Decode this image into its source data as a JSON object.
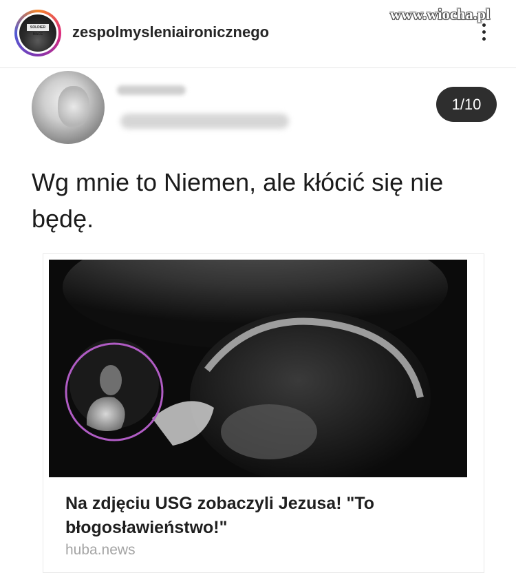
{
  "header": {
    "username": "zespolmysleniaironicznego",
    "avatar_sign_text": "SOLDIER MACE",
    "watermark": "www.wiocha.pl"
  },
  "post": {
    "counter": "1/10",
    "caption": "Wg mnie to Niemen, ale kłócić się nie będę."
  },
  "link_card": {
    "title": "Na zdjęciu USG zobaczyli Jezusa! \"To błogosławieństwo!\"",
    "domain": "huba.news",
    "circle_color": "#b05cc4"
  },
  "colors": {
    "story_ring": [
      "#f58529",
      "#dd2a7b",
      "#8134af",
      "#515bd4"
    ],
    "counter_bg": "#2e2e2e"
  }
}
